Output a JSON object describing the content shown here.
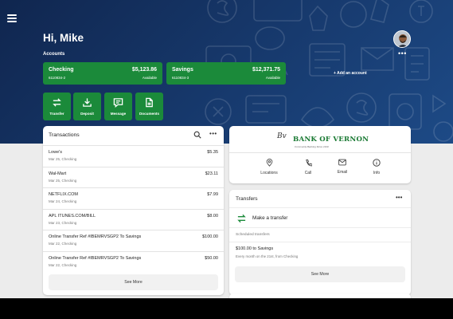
{
  "user": {
    "greeting": "Hi, Mike"
  },
  "accounts": {
    "label": "Accounts",
    "items": [
      {
        "name": "Checking",
        "balance": "$5,123.86",
        "number": "6110834-2",
        "available": "Available"
      },
      {
        "name": "Savings",
        "balance": "$12,371.75",
        "number": "6110834-3",
        "available": "Available"
      }
    ],
    "add_label": "+ Add an account"
  },
  "quick_actions": [
    {
      "label": "Transfer",
      "icon": "transfer-icon"
    },
    {
      "label": "Deposit",
      "icon": "deposit-icon"
    },
    {
      "label": "Message",
      "icon": "message-icon"
    },
    {
      "label": "Documents",
      "icon": "documents-icon"
    }
  ],
  "transactions": {
    "title": "Transactions",
    "items": [
      {
        "desc": "Lowe's",
        "sub": "Mar 25, Checking",
        "amount": "$5.35"
      },
      {
        "desc": "Wal-Mart",
        "sub": "Mar 25, Checking",
        "amount": "$23.11"
      },
      {
        "desc": "NETFLIX.COM",
        "sub": "Mar 24, Checking",
        "amount": "$7.99"
      },
      {
        "desc": "APL ITUNES.COM/BILL",
        "sub": "Mar 23, Checking",
        "amount": "$8.00"
      },
      {
        "desc": "Online Transfer Ref #IBEMRVSGP2 To Savings",
        "sub": "Mar 22, Checking",
        "amount": "$100.00"
      },
      {
        "desc": "Online Transfer Ref #IBEMRVSGP2 To Savings",
        "sub": "Mar 22, Checking",
        "amount": "$50.00"
      }
    ],
    "see_more": "See More"
  },
  "bank": {
    "name": "BANK OF VERNON",
    "signature": "Bv",
    "tagline": "Community Banking Since 1910",
    "links": [
      {
        "label": "Locations",
        "icon": "location-pin-icon"
      },
      {
        "label": "Call",
        "icon": "phone-icon"
      },
      {
        "label": "Email",
        "icon": "mail-icon"
      },
      {
        "label": "Info",
        "icon": "info-icon"
      }
    ]
  },
  "transfers": {
    "title": "Transfers",
    "make_label": "Make a transfer",
    "scheduled_label": "Scheduled transfers",
    "scheduled": {
      "amount_line": "$100.00 to Savings",
      "detail": "Every month on the 21st, from Checking"
    },
    "see_more": "See More"
  },
  "colors": {
    "brand_green": "#1b8a3a",
    "hero_navy": "#173a6e",
    "logo_green": "#1b7a34"
  }
}
